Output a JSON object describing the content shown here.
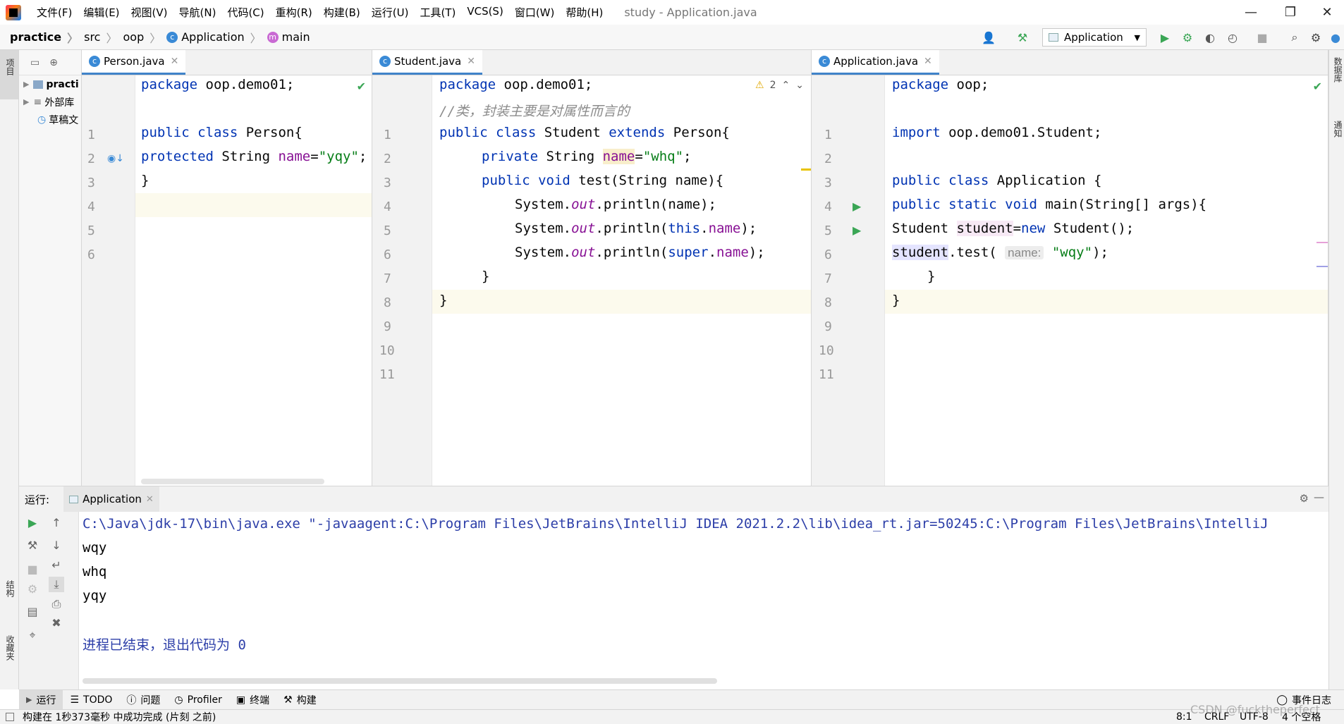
{
  "menu": [
    "文件(F)",
    "编辑(E)",
    "视图(V)",
    "导航(N)",
    "代码(C)",
    "重构(R)",
    "构建(B)",
    "运行(U)",
    "工具(T)",
    "VCS(S)",
    "窗口(W)",
    "帮助(H)"
  ],
  "window_title": "study - Application.java",
  "breadcrumb": {
    "project": "practice",
    "src": "src",
    "pkg": "oop",
    "cls": "Application",
    "method": "main"
  },
  "run_config": "Application",
  "left_strip": {
    "project": "项目",
    "structure": "结构",
    "favorites": "收藏夹"
  },
  "right_strip": {
    "database": "数据库",
    "maven": "通知"
  },
  "project_tree": {
    "root": "practi",
    "external": "外部库",
    "scratch": "草稿文"
  },
  "editors": {
    "person": {
      "tab": "Person.java",
      "lines": [
        "1",
        "2",
        "3",
        "4",
        "5",
        "6"
      ],
      "code": {
        "l1a": "package",
        "l1b": " oop.demo01;",
        "l3a": "public class",
        "l3b": " Person{",
        "l4a": "protected",
        "l4b": " String ",
        "l4c": "name",
        "l4d": "=",
        "l4e": "\"yqy\"",
        "l4f": ";",
        "l5": "}"
      }
    },
    "student": {
      "tab": "Student.java",
      "warn_count": "2",
      "lines": [
        "1",
        "2",
        "3",
        "4",
        "5",
        "6",
        "7",
        "8",
        "9",
        "10",
        "11"
      ],
      "code": {
        "l1a": "package",
        "l1b": " oop.demo01;",
        "l2": "//类，封装主要是对属性而言的",
        "l3a": "public class",
        "l3b": " Student ",
        "l3c": "extends",
        "l3d": " Person{",
        "l4a": "private",
        "l4b": " String ",
        "l4c": "name",
        "l4d": "=",
        "l4e": "\"whq\"",
        "l4f": ";",
        "l5a": "public void",
        "l5b": " test(String name){",
        "l6a": "System.",
        "l6b": "out",
        "l6c": ".println(name);",
        "l7a": "System.",
        "l7b": "out",
        "l7c": ".println(",
        "l7d": "this",
        "l7e": ".",
        "l7f": "name",
        "l7g": ");",
        "l8a": "System.",
        "l8b": "out",
        "l8c": ".println(",
        "l8d": "super",
        "l8e": ".",
        "l8f": "name",
        "l8g": ");",
        "l9": "}",
        "l10": "}"
      }
    },
    "application": {
      "tab": "Application.java",
      "lines": [
        "1",
        "2",
        "3",
        "4",
        "5",
        "6",
        "7",
        "8",
        "9",
        "10",
        "11"
      ],
      "code": {
        "l1a": "package",
        "l1b": " oop;",
        "l3a": "import",
        "l3b": " oop.demo01.Student;",
        "l5a": "public class",
        "l5b": " Application {",
        "l6a": "public static void",
        "l6b": " main(String[] args){",
        "l7a": "Student ",
        "l7b": "student",
        "l7c": "=",
        "l7d": "new",
        "l7e": " Student();",
        "l8a": "student",
        "l8b": ".test( ",
        "l8hint": "name:",
        "l8c": " ",
        "l8d": "\"wqy\"",
        "l8e": ");",
        "l9": "}",
        "l10": "}"
      }
    }
  },
  "run_panel": {
    "label": "运行:",
    "tab": "Application",
    "cmd": "C:\\Java\\jdk-17\\bin\\java.exe \"-javaagent:C:\\Program Files\\JetBrains\\IntelliJ IDEA 2021.2.2\\lib\\idea_rt.jar=50245:C:\\Program Files\\JetBrains\\IntelliJ",
    "out1": "wqy",
    "out2": "whq",
    "out3": "yqy",
    "exit": "进程已结束，退出代码为 0"
  },
  "bottom_tabs": {
    "run": "运行",
    "todo": "TODO",
    "problems": "问题",
    "profiler": "Profiler",
    "terminal": "终端",
    "build": "构建",
    "eventlog": "事件日志"
  },
  "status": {
    "message": "构建在 1秒373毫秒 中成功完成 (片刻 之前)",
    "position": "8:1",
    "line_sep": "CRLF",
    "encoding": "UTF-8",
    "indent": "4 个空格",
    "watermark": "CSDN @fucktheperfect"
  },
  "colors": {
    "keyword": "#0033b3",
    "string": "#067d17",
    "field": "#871094",
    "comment": "#8c8c8c",
    "run_green": "#3aa655",
    "console_blue": "#2c3ea8"
  }
}
